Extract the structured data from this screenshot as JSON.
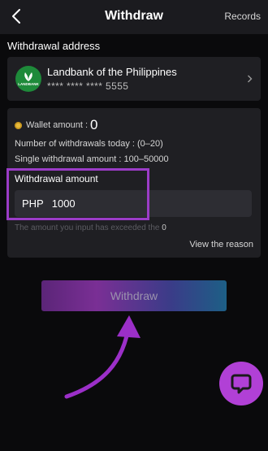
{
  "header": {
    "title": "Withdraw",
    "records_label": "Records",
    "back_icon": "chevron-left-icon"
  },
  "bank_section": {
    "label": "Withdrawal address",
    "bank_name": "Landbank of the Philippines",
    "account_masked": "**** **** **** 5555",
    "logo_text": "LANDBANK"
  },
  "wallet": {
    "label": "Wallet amount :",
    "value": "0"
  },
  "limits": {
    "count_line": "Number of withdrawals today : (0–20)",
    "single_line": "Single withdrawal amount :  100–50000"
  },
  "amount": {
    "heading": "Withdrawal amount",
    "currency": "PHP",
    "value": "1000"
  },
  "notice": {
    "text": "The amount you input has exceeded the",
    "value": "0"
  },
  "reason_link": "View the reason",
  "withdraw_button": "Withdraw",
  "colors": {
    "accent": "#b140d6",
    "highlight": "#9b3cc7",
    "bank_logo": "#1e8a3a"
  }
}
